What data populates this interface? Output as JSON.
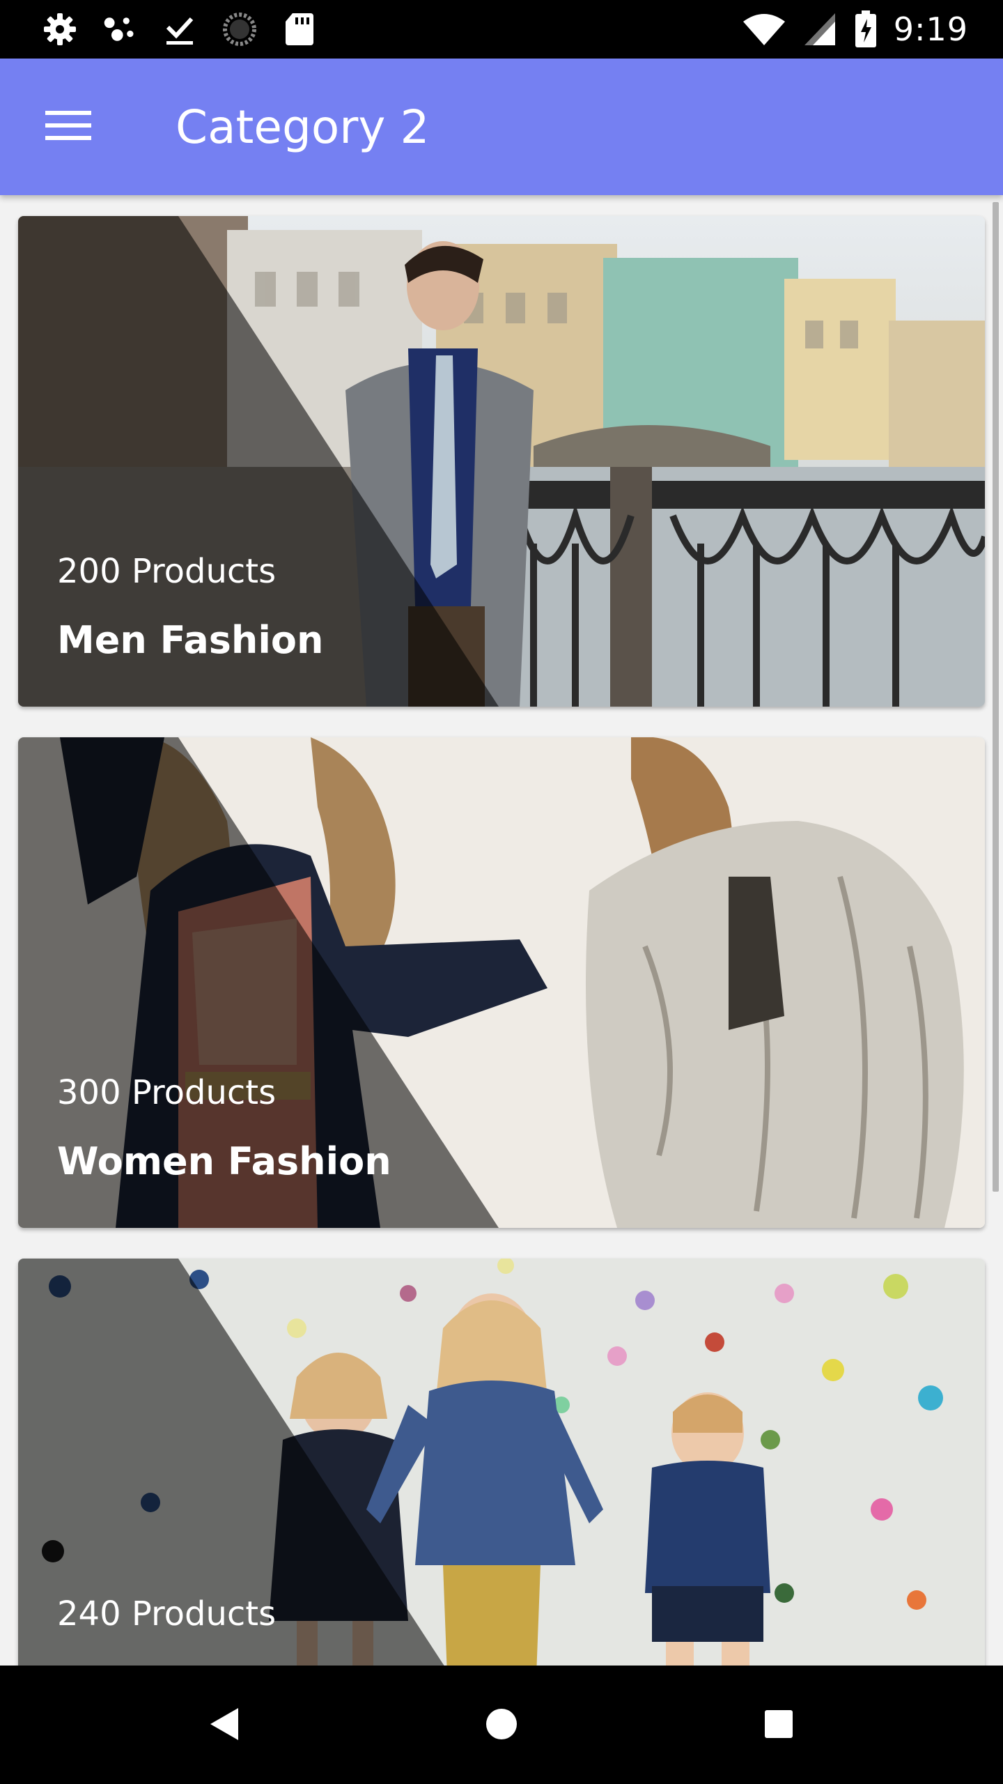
{
  "status_bar": {
    "time": "9:19",
    "left_icons": [
      "gear-icon",
      "assistant-dots-icon",
      "download-done-icon",
      "progress-spinner-icon",
      "sd-card-icon"
    ],
    "right_icons": [
      "wifi-icon",
      "signal-icon",
      "battery-charging-icon"
    ]
  },
  "app_bar": {
    "menu_icon": "menu-icon",
    "title": "Category 2",
    "color": "#7580f2"
  },
  "categories": [
    {
      "count": "200 Products",
      "name": "Men Fashion"
    },
    {
      "count": "300 Products",
      "name": "Women Fashion"
    },
    {
      "count": "240 Products",
      "name": ""
    }
  ],
  "nav_bar": {
    "buttons": [
      "back-icon",
      "home-icon",
      "recents-icon"
    ]
  }
}
